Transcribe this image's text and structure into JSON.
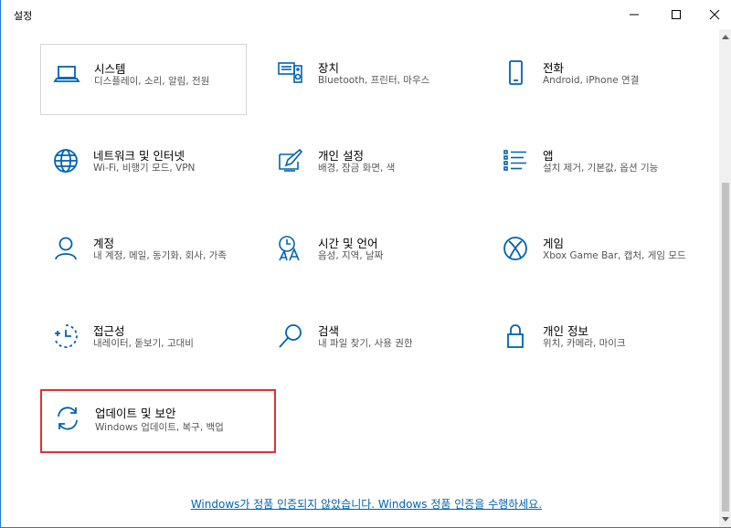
{
  "window": {
    "title": "설정"
  },
  "tiles": [
    {
      "label": "시스템",
      "desc": "디스플레이, 소리, 알림, 전원",
      "icon": "laptop-icon"
    },
    {
      "label": "장치",
      "desc": "Bluetooth, 프린터, 마우스",
      "icon": "devices-icon"
    },
    {
      "label": "전화",
      "desc": "Android, iPhone 연결",
      "icon": "phone-icon"
    },
    {
      "label": "네트워크 및 인터넷",
      "desc": "Wi-Fi, 비행기 모드, VPN",
      "icon": "globe-icon"
    },
    {
      "label": "개인 설정",
      "desc": "배경, 잠금 화면, 색",
      "icon": "personalization-icon"
    },
    {
      "label": "앱",
      "desc": "설치 제거, 기본값, 옵션 기능",
      "icon": "apps-list-icon"
    },
    {
      "label": "계정",
      "desc": "내 계정, 메일, 동기화, 회사, 가족",
      "icon": "person-icon"
    },
    {
      "label": "시간 및 언어",
      "desc": "음성, 지역, 날짜",
      "icon": "time-language-icon"
    },
    {
      "label": "게임",
      "desc": "Xbox Game Bar, 캡처, 게임 모드",
      "icon": "xbox-icon"
    },
    {
      "label": "접근성",
      "desc": "내레이터, 돋보기, 고대비",
      "icon": "ease-of-access-icon"
    },
    {
      "label": "검색",
      "desc": "내 파일 찾기, 사용 권한",
      "icon": "search-icon"
    },
    {
      "label": "개인 정보",
      "desc": "위치, 카메라, 마이크",
      "icon": "lock-icon"
    },
    {
      "label": "업데이트 및 보안",
      "desc": "Windows 업데이트, 복구, 백업",
      "icon": "update-icon"
    }
  ],
  "footer": {
    "activation_link": "Windows가 정품 인증되지 않았습니다. Windows 정품 인증을 수행하세요."
  },
  "colors": {
    "accent": "#0063b1",
    "highlight_border": "#e03232",
    "hover_border": "#d6d6d6"
  }
}
